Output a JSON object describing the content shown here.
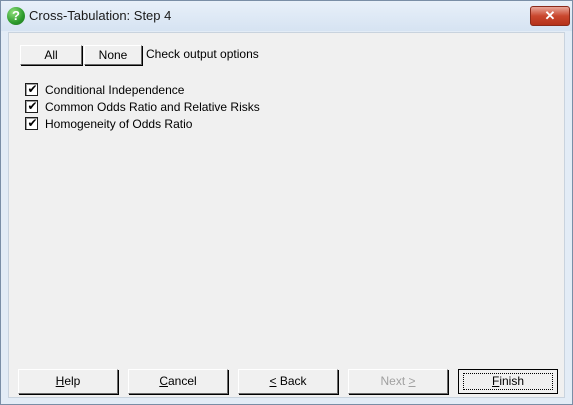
{
  "window": {
    "title": "Cross-Tabulation: Step 4",
    "close_glyph": "✕"
  },
  "top": {
    "all_label": "All",
    "none_label": "None",
    "label": "Check output options"
  },
  "options": [
    {
      "label": "Conditional Independence",
      "checked": true
    },
    {
      "label": "Common Odds Ratio and Relative Risks",
      "checked": true
    },
    {
      "label": "Homogeneity of Odds Ratio",
      "checked": true
    }
  ],
  "buttons": {
    "help": {
      "mnemonic": "H",
      "rest": "elp"
    },
    "cancel": {
      "mnemonic": "C",
      "rest": "ancel"
    },
    "back": {
      "mnemonic": "<",
      "rest": " Back"
    },
    "next": {
      "pre": "Next ",
      "mnemonic": ">"
    },
    "finish": {
      "mnemonic": "F",
      "rest": "inish"
    }
  }
}
